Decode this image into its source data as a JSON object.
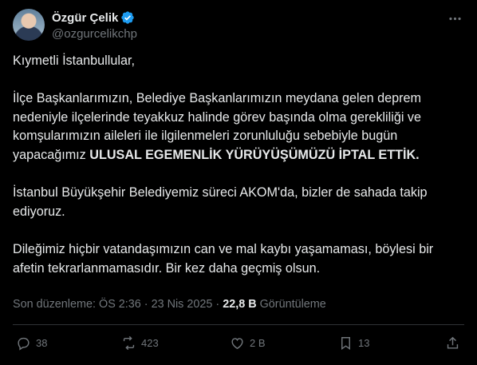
{
  "author": {
    "display_name": "Özgür Çelik",
    "handle": "@ozgurcelikchp",
    "verified_badge_color": "#1d9bf0"
  },
  "post": {
    "greeting": "Kıymetli İstanbullular,",
    "paragraph1_part1": "İlçe Başkanlarımızın, Belediye Başkanlarımızın meydana gelen deprem nedeniyle ilçelerinde teyakkuz halinde görev başında olma gerekliliği ve komşularımızın aileleri ile ilgilenmeleri zorunluluğu sebebiyle bugün yapacağımız ",
    "paragraph1_bold": "ULUSAL EGEMENLİK YÜRÜYÜŞÜMÜZÜ İPTAL ETTİK.",
    "paragraph2": "İstanbul Büyükşehir Belediyemiz süreci AKOM'da, bizler de sahada takip ediyoruz.",
    "paragraph3": "Dileğimiz hiçbir vatandaşımızın can ve mal kaybı yaşamaması, böylesi bir afetin tekrarlanmamasıdır. Bir kez daha geçmiş olsun."
  },
  "meta": {
    "edited_label": "Son düzenleme: ÖS 2:36 · 23 Nis 2025 · ",
    "views_count": "22,8 B",
    "views_label": " Görüntüleme"
  },
  "actions": {
    "replies": "38",
    "reposts": "423",
    "likes": "2 B",
    "bookmarks": "13"
  },
  "icons": [
    "more-icon",
    "verified-icon",
    "reply-icon",
    "repost-icon",
    "like-icon",
    "bookmark-icon",
    "share-icon"
  ]
}
